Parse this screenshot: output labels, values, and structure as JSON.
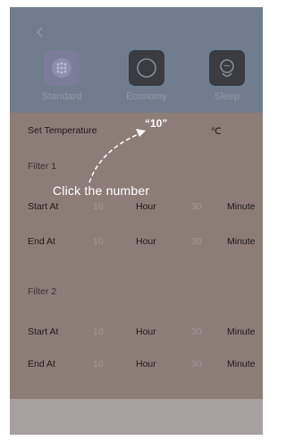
{
  "header": {
    "modes": [
      {
        "label": "Standard",
        "icon": "dots-grid-icon"
      },
      {
        "label": "Economy",
        "icon": "eco-circle-icon"
      },
      {
        "label": "Sleep",
        "icon": "sleep-face-icon"
      }
    ]
  },
  "settings": {
    "set_temperature_label": "Set Temperature",
    "temperature_value": "“10”",
    "temperature_unit": "℃",
    "filters": [
      {
        "title": "Filter 1",
        "start": {
          "label": "Start At",
          "hour_value": "10",
          "hour_unit": "Hour",
          "minute_value": "30",
          "minute_unit": "Minute"
        },
        "end": {
          "label": "End At",
          "hour_value": "10",
          "hour_unit": "Hour",
          "minute_value": "30",
          "minute_unit": "Minute"
        }
      },
      {
        "title": "Filter 2",
        "start": {
          "label": "Start At",
          "hour_value": "10",
          "hour_unit": "Hour",
          "minute_value": "30",
          "minute_unit": "Minute"
        },
        "end": {
          "label": "End At",
          "hour_value": "10",
          "hour_unit": "Hour",
          "minute_value": "30",
          "minute_unit": "Minute"
        }
      }
    ]
  },
  "annotation": {
    "text": "Click the number"
  },
  "colors": {
    "topbar": "#6f7d8c",
    "body": "#8d7d77",
    "footer": "#a7a0a1",
    "annotation": "#ffffff"
  }
}
